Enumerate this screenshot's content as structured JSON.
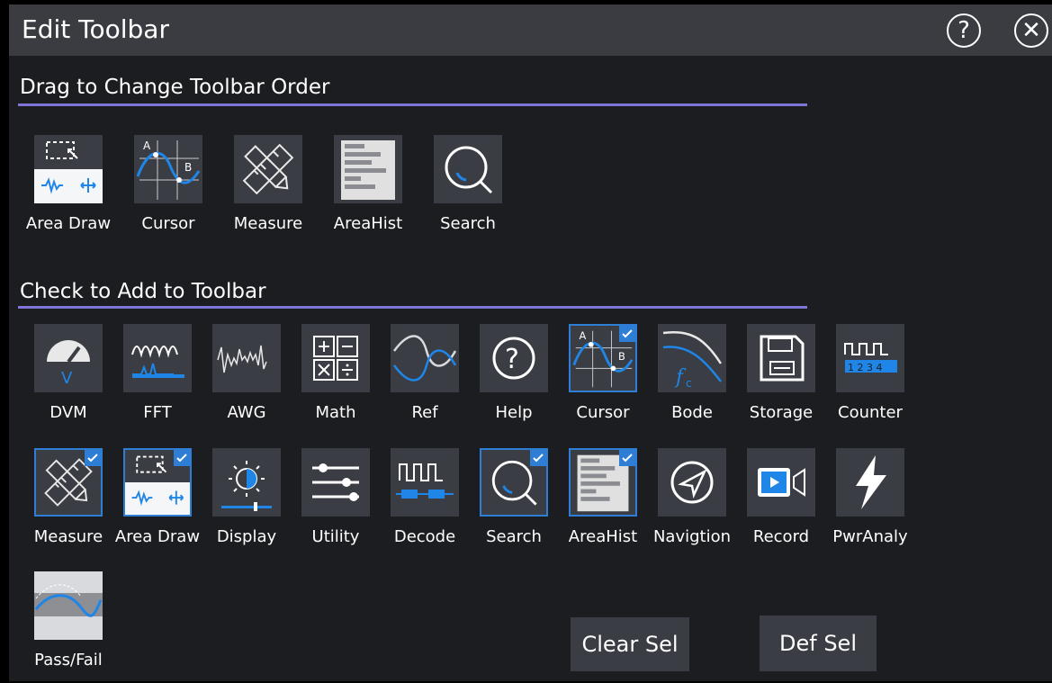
{
  "window": {
    "title": "Edit Toolbar"
  },
  "order_section": {
    "title": "Drag to Change Toolbar Order",
    "items": [
      {
        "label": "Area Draw",
        "icon": "area-draw-icon"
      },
      {
        "label": "Cursor",
        "icon": "cursor-icon"
      },
      {
        "label": "Measure",
        "icon": "measure-icon"
      },
      {
        "label": "AreaHist",
        "icon": "areahist-icon"
      },
      {
        "label": "Search",
        "icon": "search-icon"
      }
    ]
  },
  "add_section": {
    "title": "Check to Add to Toolbar",
    "items": [
      {
        "label": "DVM",
        "icon": "dvm-icon",
        "checked": false
      },
      {
        "label": "FFT",
        "icon": "fft-icon",
        "checked": false
      },
      {
        "label": "AWG",
        "icon": "awg-icon",
        "checked": false
      },
      {
        "label": "Math",
        "icon": "math-icon",
        "checked": false
      },
      {
        "label": "Ref",
        "icon": "ref-icon",
        "checked": false
      },
      {
        "label": "Help",
        "icon": "help-icon",
        "checked": false
      },
      {
        "label": "Cursor",
        "icon": "cursor-icon",
        "checked": true
      },
      {
        "label": "Bode",
        "icon": "bode-icon",
        "checked": false
      },
      {
        "label": "Storage",
        "icon": "storage-icon",
        "checked": false
      },
      {
        "label": "Counter",
        "icon": "counter-icon",
        "checked": false
      },
      {
        "label": "Measure",
        "icon": "measure-icon",
        "checked": true
      },
      {
        "label": "Area Draw",
        "icon": "area-draw-icon",
        "checked": true
      },
      {
        "label": "Display",
        "icon": "display-icon",
        "checked": false
      },
      {
        "label": "Utility",
        "icon": "utility-icon",
        "checked": false
      },
      {
        "label": "Decode",
        "icon": "decode-icon",
        "checked": false
      },
      {
        "label": "Search",
        "icon": "search-icon",
        "checked": true
      },
      {
        "label": "AreaHist",
        "icon": "areahist-icon",
        "checked": true
      },
      {
        "label": "Navigtion",
        "icon": "navigation-icon",
        "checked": false
      },
      {
        "label": "Record",
        "icon": "record-icon",
        "checked": false
      },
      {
        "label": "PwrAnaly",
        "icon": "power-analysis-icon",
        "checked": false
      },
      {
        "label": "Pass/Fail",
        "icon": "pass-fail-icon",
        "checked": false
      }
    ]
  },
  "buttons": {
    "clear": "Clear Sel",
    "default": "Def Sel"
  },
  "colors": {
    "accent": "#7f74d8",
    "selection": "#2e7ed6",
    "wave": "#1f86e8"
  }
}
